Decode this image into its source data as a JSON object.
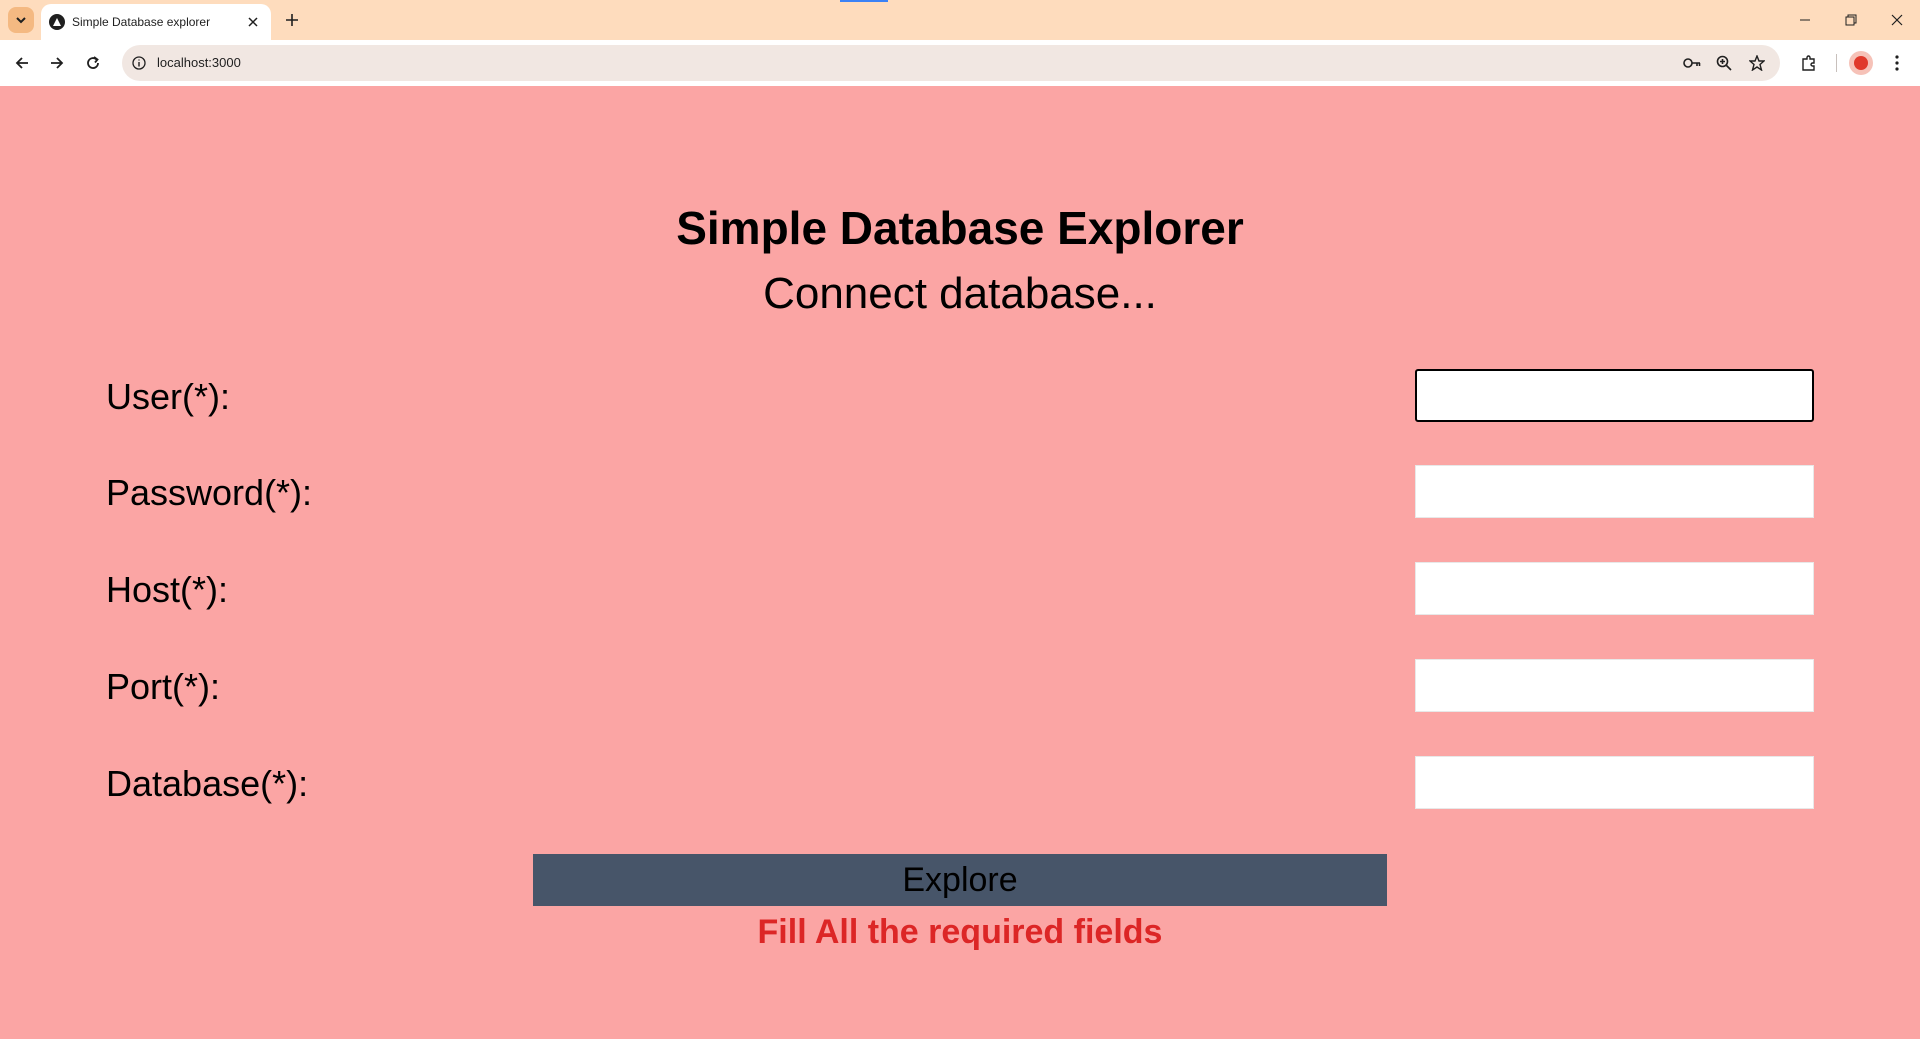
{
  "browser": {
    "tab_title": "Simple Database explorer",
    "url": "localhost:3000",
    "icons": {
      "tab_menu": "chevron-down-icon",
      "favicon": "triangle-logo-icon",
      "tab_close": "close-icon",
      "new_tab": "plus-icon",
      "back": "arrow-left-icon",
      "forward": "arrow-right-icon",
      "reload": "reload-icon",
      "site_info": "info-icon",
      "password": "key-icon",
      "zoom": "zoom-icon",
      "bookmark": "star-icon",
      "extensions": "puzzle-icon",
      "profile": "avatar-icon",
      "menu": "kebab-menu-icon",
      "minimize": "minimize-icon",
      "restore": "restore-icon",
      "close_window": "close-icon"
    }
  },
  "page": {
    "title": "Simple Database Explorer",
    "subtitle": "Connect database...",
    "fields": [
      {
        "label": "User(*):",
        "value": ""
      },
      {
        "label": "Password(*):",
        "value": ""
      },
      {
        "label": "Host(*):",
        "value": ""
      },
      {
        "label": "Port(*):",
        "value": ""
      },
      {
        "label": "Database(*):",
        "value": ""
      }
    ],
    "explore_label": "Explore",
    "error_message": "Fill All the required fields"
  },
  "colors": {
    "page_background": "#fba5a4",
    "button_background": "#475569",
    "error_text": "#dc2626",
    "titlebar": "#fedcbd"
  }
}
